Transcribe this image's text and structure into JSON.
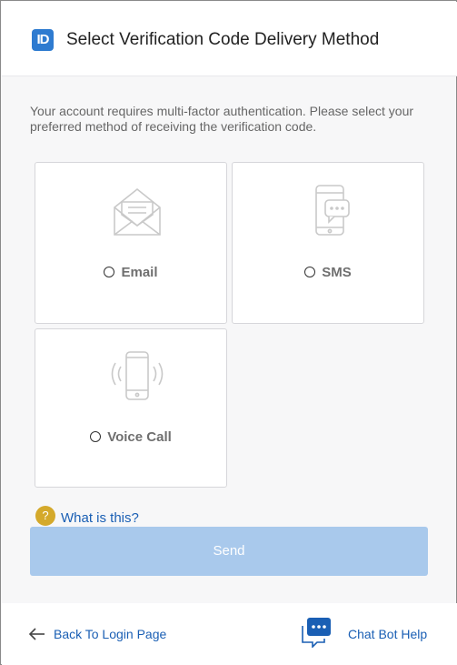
{
  "header": {
    "logo_text": "ID",
    "title": "Select Verification Code Delivery Method"
  },
  "intro": "Your account requires multi-factor authentication. Please select your preferred method of receiving the verification code.",
  "options": [
    {
      "label": "Email",
      "icon": "envelope-icon",
      "selected": false
    },
    {
      "label": "SMS",
      "icon": "phone-message-icon",
      "selected": false
    },
    {
      "label": "Voice Call",
      "icon": "phone-ringing-icon",
      "selected": false
    }
  ],
  "help": {
    "icon_text": "?",
    "label": "What is this?"
  },
  "send_label": "Send",
  "footer": {
    "back_label": "Back To Login Page",
    "chat_label": "Chat Bot Help",
    "chat_icon_text": "•••"
  },
  "colors": {
    "accent": "#1a5fb4",
    "logo": "#2e7bd0",
    "send_disabled": "#a9c9ec",
    "help_icon": "#d4a92b"
  }
}
